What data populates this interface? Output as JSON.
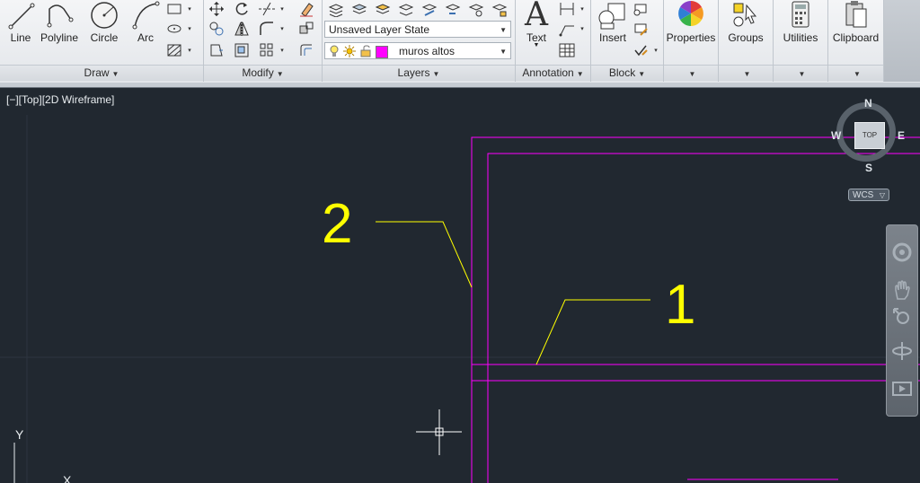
{
  "ribbon": {
    "draw": {
      "title": "Draw",
      "tools": [
        {
          "label": "Line",
          "icon": "line-icon"
        },
        {
          "label": "Polyline",
          "icon": "polyline-icon"
        },
        {
          "label": "Circle",
          "icon": "circle-icon"
        },
        {
          "label": "Arc",
          "icon": "arc-icon"
        }
      ]
    },
    "modify": {
      "title": "Modify"
    },
    "layers": {
      "title": "Layers",
      "layer_state": "Unsaved Layer State",
      "current_layer": "muros altos",
      "layer_color": "#ff00ff"
    },
    "annotation": {
      "title": "Annotation",
      "text_label": "Text"
    },
    "block": {
      "title": "Block",
      "insert_label": "Insert"
    },
    "big_tools": [
      {
        "label": "Properties"
      },
      {
        "label": "Groups"
      },
      {
        "label": "Utilities"
      },
      {
        "label": "Clipboard"
      }
    ]
  },
  "viewport": {
    "label": "[−][Top][2D Wireframe]",
    "annotations": [
      "2",
      "1"
    ],
    "ucs_y": "Y",
    "ucs_x": "X",
    "background": "#212830",
    "geometry_color": "#ff00ff",
    "leader_color": "#ffff00"
  },
  "viewcube": {
    "n": "N",
    "s": "S",
    "e": "E",
    "w": "W",
    "top": "TOP",
    "wcs": "WCS"
  }
}
